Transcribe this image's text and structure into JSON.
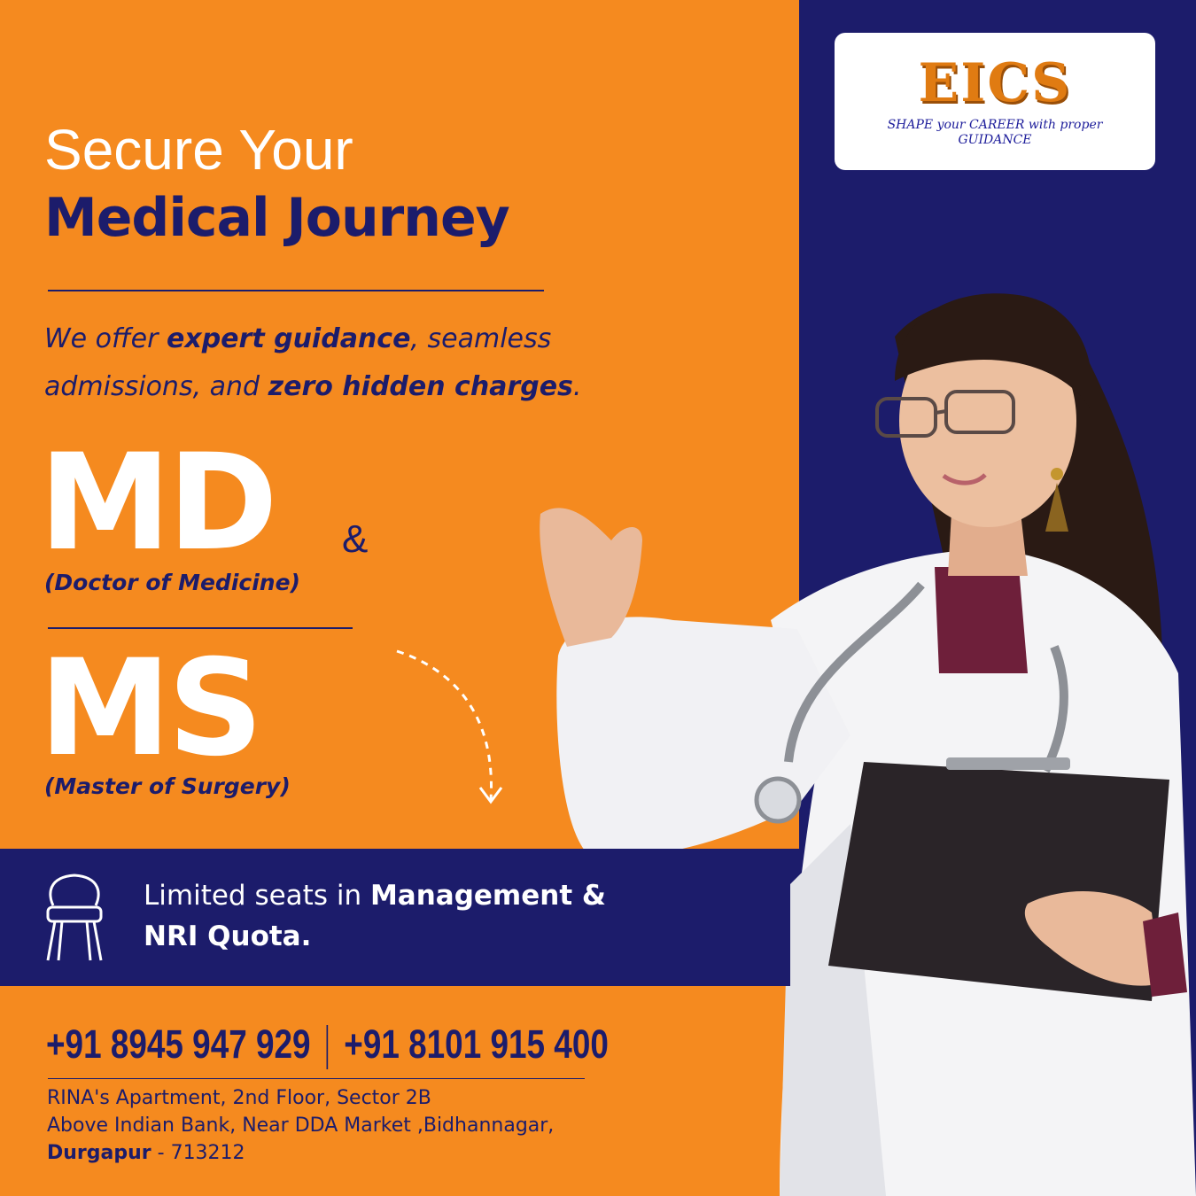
{
  "brand": {
    "logo_text": "EICS",
    "tagline_line1": "SHAPE your CAREER with proper",
    "tagline_line2": "GUIDANCE"
  },
  "headline": {
    "line1": "Secure Your",
    "line2": "Medical Journey"
  },
  "offer": {
    "part1": "We offer ",
    "bold1": "expert guidance",
    "part2": ", seamless admissions, and ",
    "bold2": "zero hidden charges",
    "part3": "."
  },
  "courses": {
    "md": "MD",
    "md_full": "(Doctor of Medicine)",
    "amp": "&",
    "ms": "MS",
    "ms_full": "(Master of Surgery)"
  },
  "seats": {
    "part1": "Limited seats in ",
    "bold1": "Management &",
    "bold2": "NRI Quota."
  },
  "contact": {
    "phone1": "+91 8945 947 929",
    "phone2": "+91 8101 915 400",
    "address_line1": "RINA's Apartment, 2nd Floor, Sector 2B",
    "address_line2": "Above Indian Bank, Near DDA Market ,Bidhannagar,",
    "city": "Durgapur",
    "pin": " - 713212"
  },
  "colors": {
    "orange": "#F58A1F",
    "navy": "#1C1C6B",
    "white": "#FFFFFF"
  },
  "icons": {
    "chair": "chair-icon",
    "arrow": "dashed-arrow-icon"
  }
}
